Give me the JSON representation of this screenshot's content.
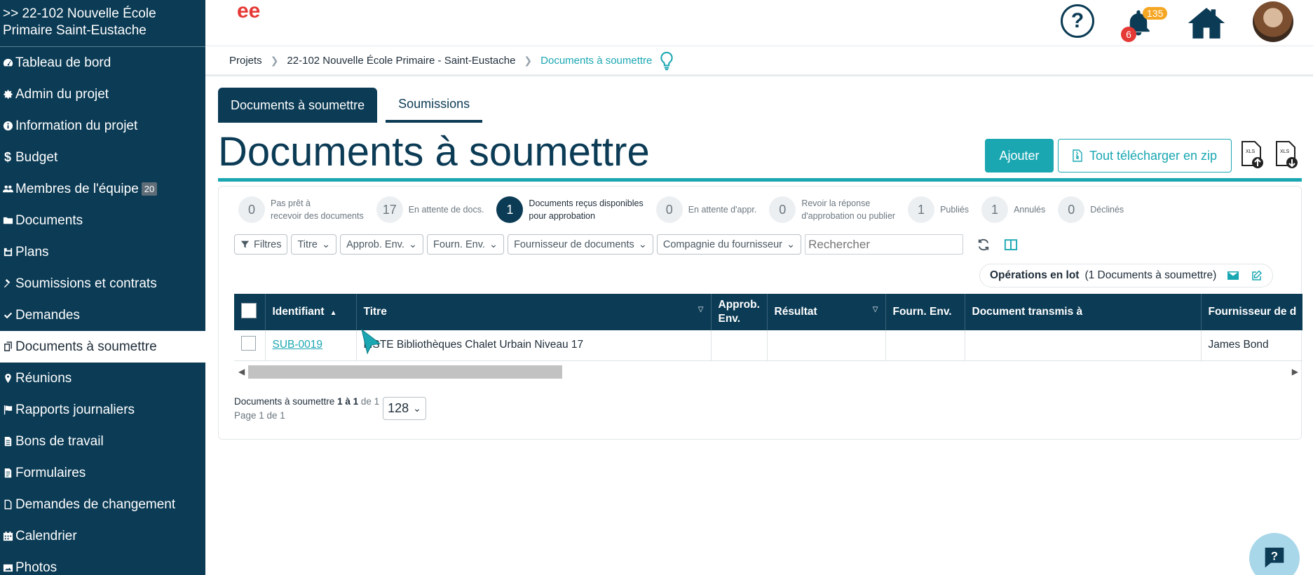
{
  "sidebar": {
    "project": ">> 22-102 Nouvelle École Primaire Saint-Eustache",
    "items": [
      {
        "label": "Tableau de bord",
        "icon": "dashboard-icon"
      },
      {
        "label": "Admin du projet",
        "icon": "gear-icon"
      },
      {
        "label": "Information du projet",
        "icon": "info-icon"
      },
      {
        "label": "Budget",
        "icon": "dollar-icon"
      },
      {
        "label": "Membres de l'équipe",
        "icon": "team-icon",
        "badge": "20"
      },
      {
        "label": "Documents",
        "icon": "folder-icon"
      },
      {
        "label": "Plans",
        "icon": "plans-icon"
      },
      {
        "label": "Soumissions et contrats",
        "icon": "gavel-icon"
      },
      {
        "label": "Demandes",
        "icon": "check-icon"
      },
      {
        "label": "Documents à soumettre",
        "icon": "docs-submit-icon",
        "active": true
      },
      {
        "label": "Réunions",
        "icon": "map-pin-icon"
      },
      {
        "label": "Rapports journaliers",
        "icon": "flag-icon"
      },
      {
        "label": "Bons de travail",
        "icon": "document-icon"
      },
      {
        "label": "Formulaires",
        "icon": "form-icon"
      },
      {
        "label": "Demandes de changement",
        "icon": "file-icon"
      },
      {
        "label": "Calendrier",
        "icon": "calendar-icon"
      },
      {
        "label": "Photos",
        "icon": "photo-icon"
      }
    ]
  },
  "header": {
    "logo_text": "ee",
    "help_label": "?",
    "notifications_count": "135",
    "alerts_count": "6"
  },
  "breadcrumb": {
    "items": [
      "Projets",
      "22-102 Nouvelle École Primaire - Saint-Eustache",
      "Documents à soumettre"
    ]
  },
  "tabs": [
    {
      "label": "Documents à soumettre",
      "active": true
    },
    {
      "label": "Soumissions",
      "active": false
    }
  ],
  "page": {
    "title": "Documents à soumettre",
    "add_button": "Ajouter",
    "zip_button": "Tout télécharger en zip",
    "xls_label": "XLS"
  },
  "statuses": [
    {
      "count": "0",
      "label_1": "Pas prêt à",
      "label_2": "recevoir des documents"
    },
    {
      "count": "17",
      "label_1": "En attente de docs.",
      "label_2": ""
    },
    {
      "count": "1",
      "label_1": "Documents reçus disponibles",
      "label_2": "pour approbation",
      "active": true
    },
    {
      "count": "0",
      "label_1": "En attente d'appr.",
      "label_2": ""
    },
    {
      "count": "0",
      "label_1": "Revoir la réponse",
      "label_2": "d'approbation ou publier"
    },
    {
      "count": "1",
      "label_1": "Publiés",
      "label_2": ""
    },
    {
      "count": "1",
      "label_1": "Annulés",
      "label_2": ""
    },
    {
      "count": "0",
      "label_1": "Déclinés",
      "label_2": ""
    }
  ],
  "filters": {
    "filters_label": "Filtres",
    "dropdowns": [
      "Titre",
      "Approb. Env.",
      "Fourn. Env.",
      "Fournisseur de documents",
      "Compagnie du fournisseur"
    ],
    "search_placeholder": "Rechercher"
  },
  "batch": {
    "label": "Opérations en lot",
    "detail": "(1 Documents à soumettre)"
  },
  "table": {
    "columns": [
      "Identifiant",
      "Titre",
      "Approb. Env.",
      "Résultat",
      "Fourn. Env.",
      "Document transmis à",
      "Fournisseur de d"
    ],
    "rows": [
      {
        "id": "SUB-0019",
        "title": "LISTE Bibliothèques Chalet Urbain Niveau 17",
        "approb": "",
        "result": "",
        "fourn": "",
        "transmis": "",
        "supplier": "James Bond"
      }
    ]
  },
  "pager": {
    "line1_prefix": "Documents à soumettre",
    "line1_range": "1 à 1",
    "line1_suffix": "de 1",
    "line2": "Page 1 de 1",
    "page_size": "128"
  },
  "colors": {
    "sidebar": "#0b3b55",
    "accent": "#1aa7b2",
    "logo": "#e53935"
  }
}
